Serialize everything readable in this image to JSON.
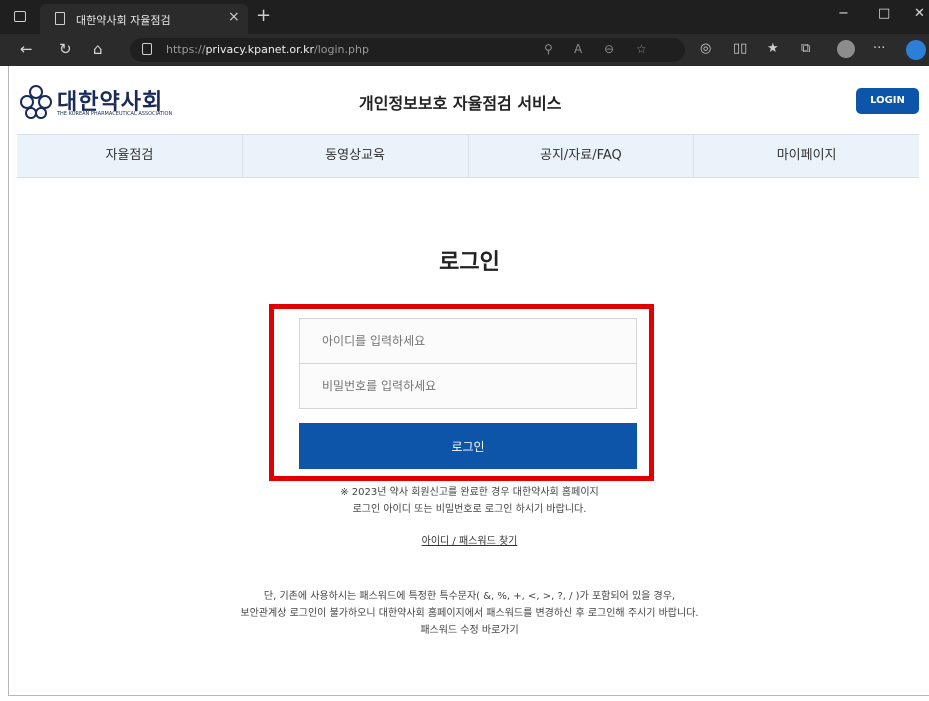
{
  "browser": {
    "tab_title": "대한약사회 자율점검",
    "tab_close": "×",
    "new_tab": "+",
    "url_scheme": "https://",
    "url_host": "privacy.kpanet.or.kr",
    "url_path": "/login.php",
    "window_controls": {
      "minimize": "−",
      "maximize": "□",
      "close": "✕"
    }
  },
  "header": {
    "logo_korean": "대한약사회",
    "logo_english": "THE KOREAN PHARMACEUTICAL ASSOCIATION",
    "site_title": "개인정보보호 자율점검 서비스",
    "login_button": "LOGIN"
  },
  "nav": {
    "items": [
      "자율점검",
      "동영상교육",
      "공지/자료/FAQ",
      "마이페이지"
    ]
  },
  "main": {
    "heading": "로그인",
    "id_placeholder": "아이디를 입력하세요",
    "pw_placeholder": "비밀번호를 입력하세요",
    "login_button": "로그인",
    "notice_line1": "※ 2023년 약사 회원신고를 완료한 경우 대한약사회 홈페이지",
    "notice_line2": "로그인 아이디 또는 비밀번호로 로그인 하시기 바랍니다.",
    "find_link": "아이디 / 패스워드 찾기",
    "bottom_line1": "단, 기존에 사용하시는 패스워드에 특정한 특수문자( &, %, +, <, >, ?, / )가 포함되어 있을 경우,",
    "bottom_line2": "보안관계상 로그인이 불가하오니 대한약사회 홈페이지에서 패스워드를 변경하신 후 로그인해 주시기 바랍니다.",
    "bottom_line3": "패스워드 수정 바로가기"
  },
  "colors": {
    "brand_blue": "#0d55a8",
    "highlight_red": "#e00000",
    "nav_bg": "#eaf2fa"
  }
}
